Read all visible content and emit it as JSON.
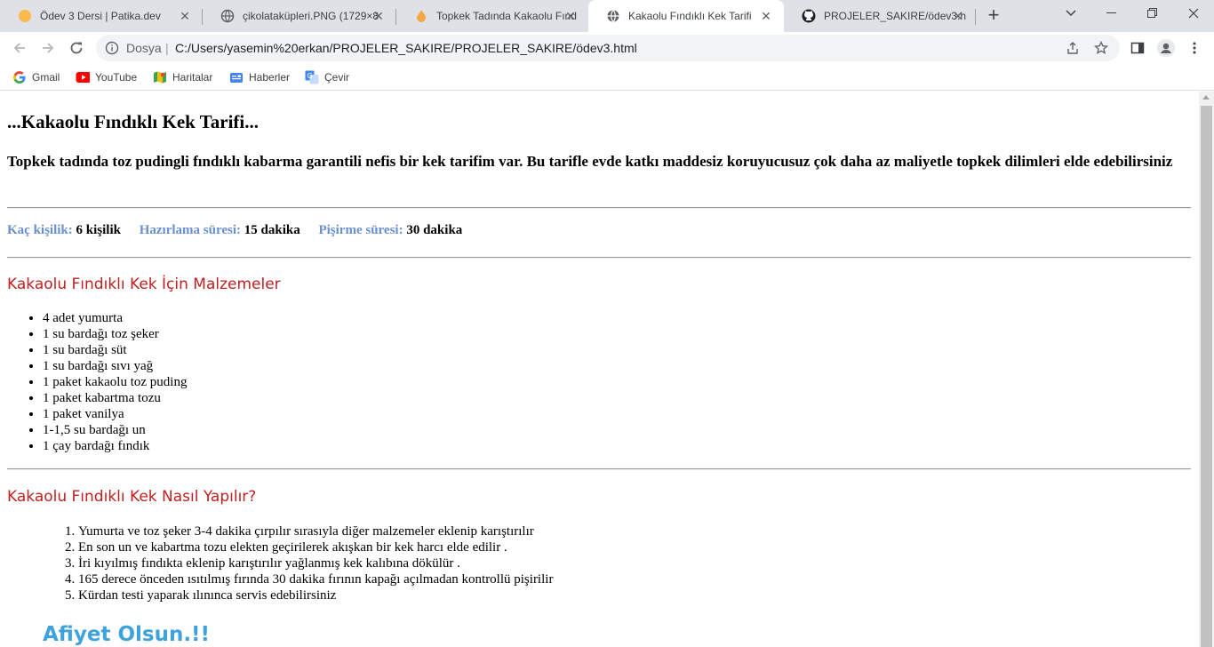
{
  "browser": {
    "tabs": [
      {
        "title": "Ödev 3 Dersi | Patika.dev",
        "icon": "patika-favicon"
      },
      {
        "title": "çikolataküpleri.PNG (1729×8",
        "icon": "globe-icon"
      },
      {
        "title": "Topkek Tadında Kakaolu Fınd",
        "icon": "flame-favicon"
      },
      {
        "title": "Kakaolu Fındıklı Kek Tarifi",
        "icon": "globe-icon"
      },
      {
        "title": "PROJELER_SAKIRE/ödev3.htm",
        "icon": "github-icon"
      }
    ],
    "omnibox": {
      "scheme_label": "Dosya",
      "url": "C:/Users/yasemin%20erkan/PROJELER_SAKIRE/PROJELER_SAKIRE/ödev3.html"
    },
    "bookmarks": [
      {
        "label": "Gmail",
        "icon": "google-icon"
      },
      {
        "label": "YouTube",
        "icon": "youtube-icon"
      },
      {
        "label": "Haritalar",
        "icon": "maps-icon"
      },
      {
        "label": "Haberler",
        "icon": "news-icon"
      },
      {
        "label": "Çevir",
        "icon": "translate-icon"
      }
    ]
  },
  "page": {
    "title": "...Kakaolu Fındıklı Kek Tarifi...",
    "intro": "Topkek tadında toz pudingli fındıklı kabarma garantili nefis bir kek tarifim var. Bu tarifle evde katkı maddesiz koruyucusuz çok daha az maliyetle topkek dilimleri elde edebilirsiniz",
    "meta": {
      "servings_label": "Kaç kişilik:",
      "servings_value": "6 kişilik",
      "prep_label": "Hazırlama süresi:",
      "prep_value": "15 dakika",
      "cook_label": "Pişirme süresi:",
      "cook_value": "30 dakika"
    },
    "ingredients_heading": "Kakaolu Fındıklı Kek İçin Malzemeler",
    "ingredients": [
      "4 adet yumurta",
      "1 su bardağı toz şeker",
      "1 su bardağı süt",
      "1 su bardağı sıvı yağ",
      "1 paket kakaolu toz puding",
      "1 paket kabartma tozu",
      "1 paket vanilya",
      "1-1,5 su bardağı un",
      "1 çay bardağı fındık"
    ],
    "steps_heading": "Kakaolu Fındıklı Kek Nasıl Yapılır?",
    "steps": [
      "Yumurta ve toz şeker 3-4 dakika çırpılır sırasıyla diğer malzemeler eklenip karıştırılır",
      "En son un ve kabartma tozu elekten geçirilerek akışkan bir kek harcı elde edilir .",
      "İri kıyılmış fındıkta eklenip karıştırılır yağlanmış kek kalıbına dökülür .",
      "165 derece önceden ısıtılmış fırında 30 dakika fırının kapağı açılmadan kontrollü pişirilir",
      "Kürdan testi yaparak ılınınca servis edebilirsiniz"
    ],
    "closing": "Afiyet Olsun.!!"
  },
  "colors": {
    "heading_red": "#c0201f",
    "meta_label_blue": "#6a8fcf",
    "closing_blue": "#3ea2dc"
  }
}
